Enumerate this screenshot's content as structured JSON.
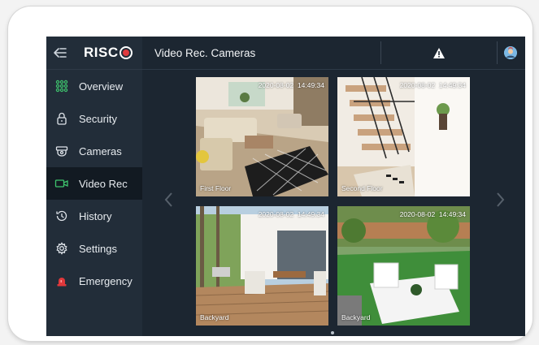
{
  "app": {
    "brand": "RISC",
    "page_title": "Video Rec. Cameras"
  },
  "sidebar": {
    "items": [
      {
        "label": "Overview",
        "icon": "grid-dots-icon",
        "active": false
      },
      {
        "label": "Security",
        "icon": "lock-icon",
        "active": false
      },
      {
        "label": "Cameras",
        "icon": "camera-icon",
        "active": false
      },
      {
        "label": "Video Rec",
        "icon": "video-icon",
        "active": true
      },
      {
        "label": "History",
        "icon": "history-icon",
        "active": false
      },
      {
        "label": "Settings",
        "icon": "gear-icon",
        "active": false
      },
      {
        "label": "Emergency",
        "icon": "siren-icon",
        "active": false
      }
    ]
  },
  "header": {
    "alert_icon": "warning-icon",
    "avatar_icon": "user-avatar-icon"
  },
  "cameras": [
    {
      "label": "First Floor",
      "date": "2020-08-02",
      "time": "14:49:34"
    },
    {
      "label": "Second Floor",
      "date": "2020-08-02",
      "time": "14:49:34"
    },
    {
      "label": "Backyard",
      "date": "2020-08-02",
      "time": "14:49:34"
    },
    {
      "label": "Backyard",
      "date": "2020-08-02",
      "time": "14:49:34"
    }
  ],
  "colors": {
    "accent": "#3ec46d",
    "alert": "#e0383b",
    "sidebar_bg": "#222d39",
    "screen_bg": "#1c2631"
  }
}
